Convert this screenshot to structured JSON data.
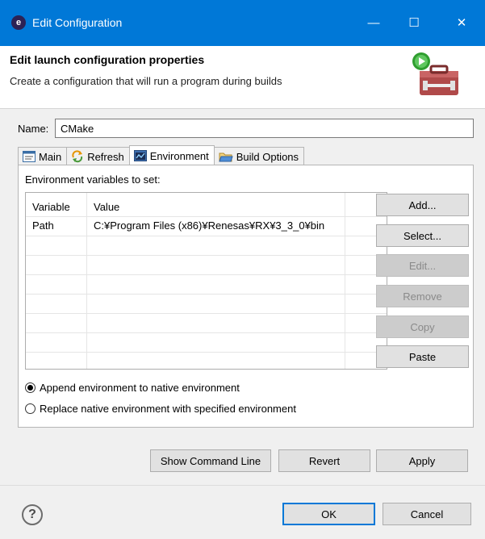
{
  "window": {
    "title": "Edit Configuration",
    "app_icon_glyph": "e",
    "minimize_glyph": "—",
    "maximize_glyph": "☐",
    "close_glyph": "✕"
  },
  "header": {
    "title": "Edit launch configuration properties",
    "description": "Create a configuration that will run a program during builds"
  },
  "name": {
    "label": "Name:",
    "value": "CMake"
  },
  "tabs": [
    {
      "label": "Main",
      "icon": "main-tab-icon"
    },
    {
      "label": "Refresh",
      "icon": "refresh-icon"
    },
    {
      "label": "Environment",
      "icon": "environment-icon",
      "active": true
    },
    {
      "label": "Build Options",
      "icon": "build-options-icon"
    }
  ],
  "environment": {
    "label": "Environment variables to set:",
    "columns": [
      "Variable",
      "Value"
    ],
    "rows": [
      {
        "variable": "Path",
        "value": "C:¥Program Files (x86)¥Renesas¥RX¥3_3_0¥bin"
      }
    ]
  },
  "side_buttons": {
    "add": "Add...",
    "select": "Select...",
    "edit": "Edit...",
    "remove": "Remove",
    "copy": "Copy",
    "paste": "Paste"
  },
  "radios": {
    "append": "Append environment to native environment",
    "replace": "Replace native environment with specified environment",
    "selected": "append"
  },
  "buttons": {
    "show_command_line": "Show Command Line",
    "revert": "Revert",
    "apply": "Apply",
    "ok": "OK",
    "cancel": "Cancel",
    "help_glyph": "?"
  },
  "colors": {
    "titlebar": "#0078d7",
    "accent": "#0078d7",
    "disabled_text": "#8a8a8a"
  }
}
